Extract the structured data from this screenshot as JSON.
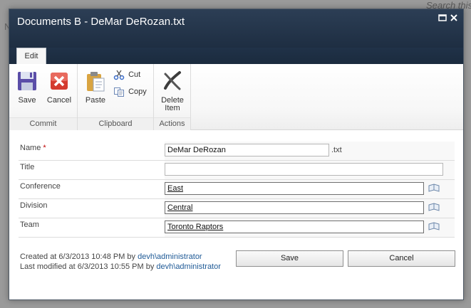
{
  "background": {
    "search_hint": "Search this site"
  },
  "dialog": {
    "title": "Documents B - DeMar DeRozan.txt",
    "maximize_glyph": "▭",
    "close_glyph": "✕"
  },
  "ribbon": {
    "tab_label": "Edit",
    "groups": {
      "commit": {
        "label": "Commit",
        "save_label": "Save",
        "cancel_label": "Cancel"
      },
      "clipboard": {
        "label": "Clipboard",
        "paste_label": "Paste",
        "cut_label": "Cut",
        "copy_label": "Copy"
      },
      "actions": {
        "label": "Actions",
        "delete_label_line1": "Delete",
        "delete_label_line2": "Item"
      }
    }
  },
  "form": {
    "required_marker": "*",
    "fields": {
      "name": {
        "label": "Name",
        "value": "DeMar DeRozan",
        "suffix": ".txt"
      },
      "title": {
        "label": "Title",
        "value": ""
      },
      "conference": {
        "label": "Conference",
        "value": "East"
      },
      "division": {
        "label": "Division",
        "value": "Central"
      },
      "team": {
        "label": "Team",
        "value": "Toronto Raptors"
      }
    }
  },
  "footer": {
    "created_prefix": "Created at 6/3/2013 10:48 PM  by ",
    "created_by": "devh\\administrator",
    "modified_prefix": "Last modified at 6/3/2013 10:55 PM  by ",
    "modified_by": "devh\\administrator",
    "save_label": "Save",
    "cancel_label": "Cancel"
  },
  "colors": {
    "title_bar": "#1e2e42",
    "link": "#1f5a96",
    "required": "#bf0000"
  },
  "icons": [
    "save-icon",
    "cancel-icon",
    "paste-icon",
    "cut-icon",
    "copy-icon",
    "delete-icon",
    "address-book-icon"
  ]
}
